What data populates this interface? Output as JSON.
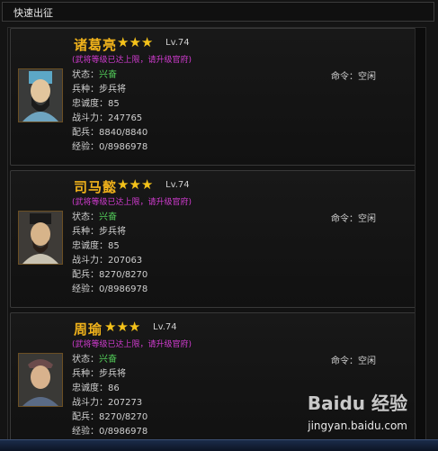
{
  "window": {
    "title": "快速出征"
  },
  "cards": [
    {
      "name": "诸葛亮",
      "stars": "★★★",
      "level": "Lv.74",
      "notice": "(武将等级已达上限，请升级官府)",
      "labels": {
        "state": "状态：",
        "troop": "兵种：",
        "loyalty": "忠诚度：",
        "power": "战斗力：",
        "soldiers": "配兵：",
        "exp": "经验："
      },
      "state": "兴奋",
      "troop": "步兵将",
      "loyalty": "85",
      "power": "247765",
      "soldiers": "8840/8840",
      "exp": "0/8986978",
      "command": "命令：空闲"
    },
    {
      "name": "司马懿",
      "stars": "★★★",
      "level": "Lv.74",
      "notice": "(武将等级已达上限，请升级官府)",
      "labels": {
        "state": "状态：",
        "troop": "兵种：",
        "loyalty": "忠诚度：",
        "power": "战斗力：",
        "soldiers": "配兵：",
        "exp": "经验："
      },
      "state": "兴奋",
      "troop": "步兵将",
      "loyalty": "85",
      "power": "207063",
      "soldiers": "8270/8270",
      "exp": "0/8986978",
      "command": "命令：空闲"
    },
    {
      "name": "周瑜",
      "stars": "★★★",
      "level": "Lv.74",
      "notice": "(武将等级已达上限，请升级官府)",
      "labels": {
        "state": "状态：",
        "troop": "兵种：",
        "loyalty": "忠诚度：",
        "power": "战斗力：",
        "soldiers": "配兵：",
        "exp": "经验："
      },
      "state": "兴奋",
      "troop": "步兵将",
      "loyalty": "86",
      "power": "207273",
      "soldiers": "8270/8270",
      "exp": "0/8986978",
      "command": "命令：空闲"
    }
  ],
  "watermark": {
    "brand": "Baidu 经验",
    "url": "jingyan.baidu.com"
  },
  "colors": {
    "name": "#f0b21b",
    "star": "#f4c21a",
    "notice": "#d13bd0",
    "state": "#53d05a"
  }
}
